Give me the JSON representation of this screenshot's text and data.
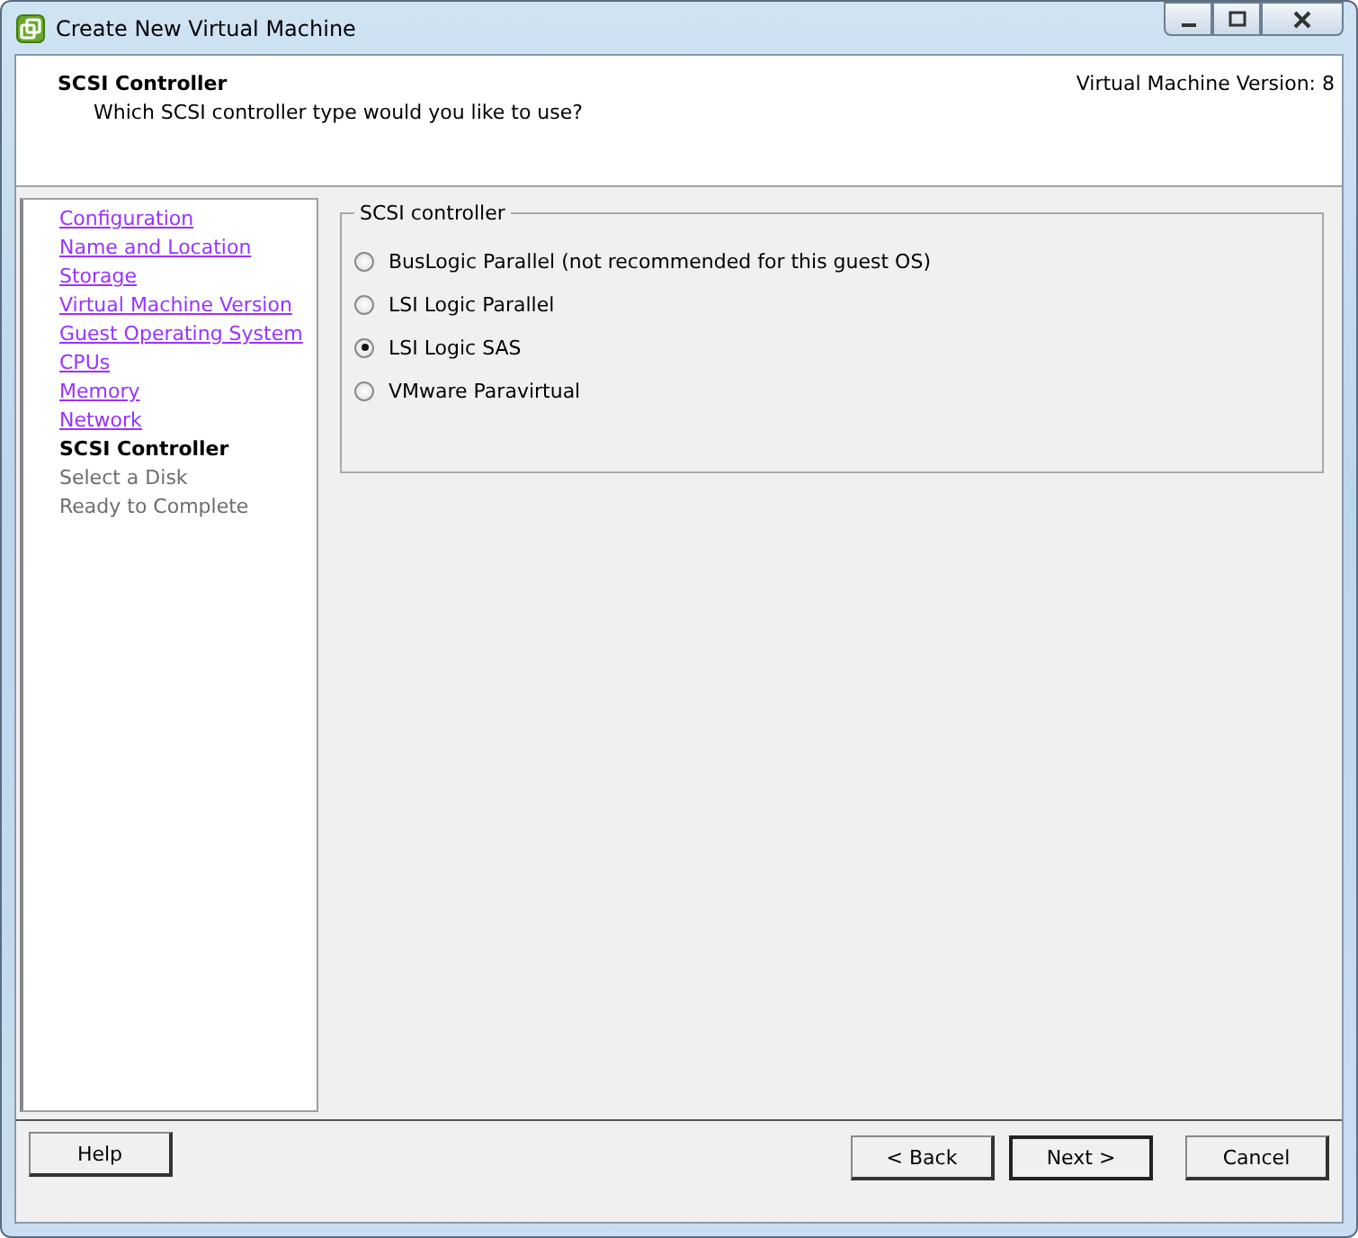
{
  "window": {
    "title": "Create New Virtual Machine"
  },
  "header": {
    "title": "SCSI Controller",
    "subtitle": "Which SCSI controller type would you like to use?",
    "version": "Virtual Machine Version: 8"
  },
  "steps": [
    {
      "label": "Configuration",
      "kind": "link"
    },
    {
      "label": "Name and Location",
      "kind": "link"
    },
    {
      "label": "Storage",
      "kind": "link"
    },
    {
      "label": "Virtual Machine Version",
      "kind": "link"
    },
    {
      "label": "Guest Operating System",
      "kind": "link"
    },
    {
      "label": "CPUs",
      "kind": "link"
    },
    {
      "label": "Memory",
      "kind": "link"
    },
    {
      "label": "Network",
      "kind": "link"
    },
    {
      "label": "SCSI Controller",
      "kind": "current"
    },
    {
      "label": "Select a Disk",
      "kind": "pending"
    },
    {
      "label": "Ready to Complete",
      "kind": "pending"
    }
  ],
  "group": {
    "title": "SCSI controller",
    "options": [
      {
        "label": "BusLogic Parallel (not recommended for this guest OS)",
        "selected": false
      },
      {
        "label": "LSI Logic Parallel",
        "selected": false
      },
      {
        "label": "LSI Logic SAS",
        "selected": true
      },
      {
        "label": "VMware Paravirtual",
        "selected": false
      }
    ]
  },
  "buttons": {
    "help": "Help",
    "back": "< Back",
    "next": "Next >",
    "cancel": "Cancel"
  }
}
